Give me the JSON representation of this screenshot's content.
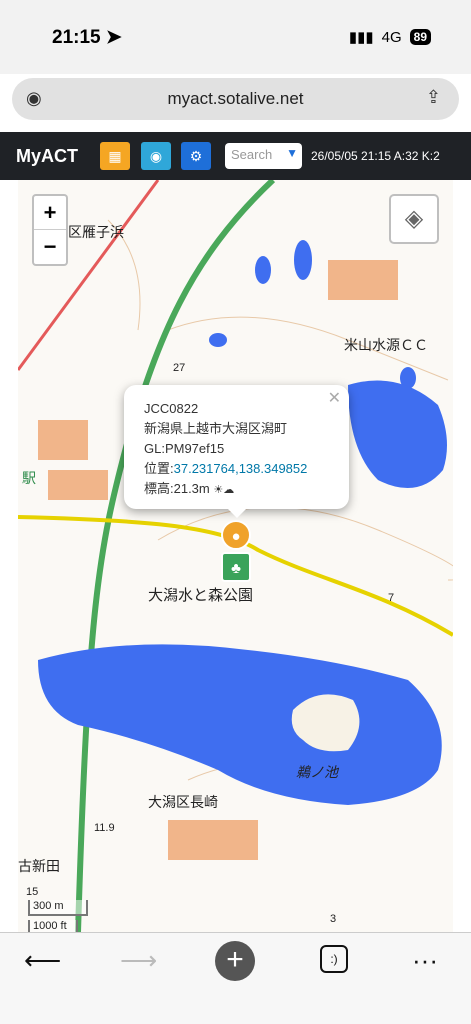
{
  "status": {
    "time": "21:15",
    "network": "4G",
    "battery": "89"
  },
  "browser": {
    "url": "myact.sotalive.net"
  },
  "header": {
    "title": "MyACT",
    "search_placeholder": "Search",
    "info": "26/05/05 21:15 A:32 K:2"
  },
  "popup": {
    "ref": "JCC0822",
    "address": "新潟県上越市大潟区潟町",
    "grid": "GL:PM97ef15",
    "position_label": "位置:",
    "position_value": "37.231764,138.349852",
    "elevation": "標高:21.3m"
  },
  "map": {
    "labels": {
      "area1": "区雁子浜",
      "golf": "米山水源ＣＣ",
      "station": "駅",
      "park": "大潟水と森公園",
      "pond": "鵜ノ池",
      "district": "大潟区長崎",
      "area2": "古新田",
      "num27": "27",
      "num7": "7",
      "num3": "3",
      "num15": "15",
      "num119": "11.9"
    },
    "scale": {
      "m": "300 m",
      "ft": "1000 ft"
    }
  },
  "colors": {
    "header_bg": "#1f2226",
    "btn_orange": "#f5a623",
    "btn_teal": "#2fa7d9",
    "btn_blue": "#1e6fd9",
    "water": "#3f6ef0",
    "marker_user": "#f0a22a",
    "marker_park": "#3aa35a"
  },
  "icons": {
    "location": "location-arrow-icon",
    "camera": "camera-icon",
    "share": "share-icon",
    "map": "map-icon",
    "radio": "radio-waves-icon",
    "settings": "gear-icon",
    "layers": "layers-icon",
    "back": "back-arrow-icon",
    "forward": "forward-arrow-icon",
    "add": "plus-icon",
    "tabs": "tabs-icon",
    "more": "more-icon"
  }
}
